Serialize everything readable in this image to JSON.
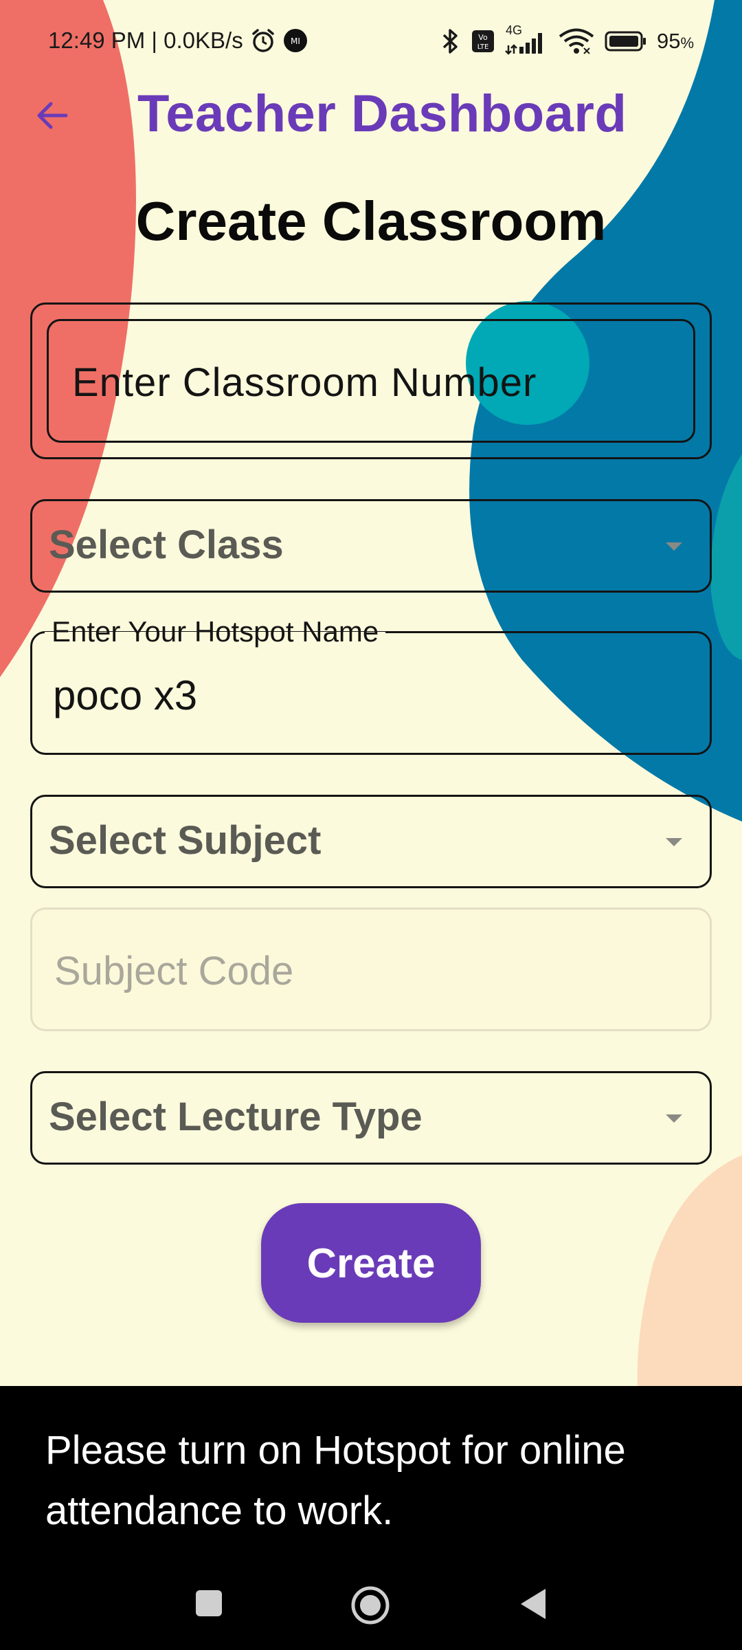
{
  "status_bar": {
    "time_speed": "12:49 PM | 0.0KB/s",
    "network": "4G",
    "volte": "Vo LTE",
    "battery": "95",
    "battery_unit": "%"
  },
  "app_bar": {
    "title": "Teacher Dashboard"
  },
  "page_title": "Create Classroom",
  "form": {
    "classroom_number_label": "Enter Classroom Number",
    "select_class_label": "Select Class",
    "hotspot_label": "Enter Your Hotspot Name",
    "hotspot_value": "poco x3",
    "select_subject_label": "Select Subject",
    "subject_code_placeholder": "Subject Code",
    "select_lecture_type_label": "Select Lecture Type",
    "create_label": "Create"
  },
  "snackbar": {
    "message": "Please turn on Hotspot for online attendance to work."
  },
  "colors": {
    "background": "#fcfadc",
    "accent": "#6a3bb8",
    "blob_red": "#ef6f66",
    "blob_blue": "#0379a8",
    "blob_teal": "#00a9b5",
    "blob_peach": "#fbdbbb"
  }
}
